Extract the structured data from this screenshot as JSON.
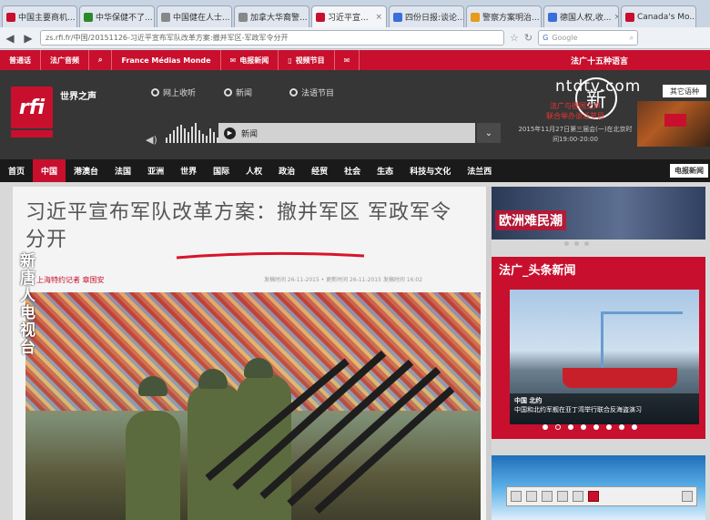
{
  "browser": {
    "tabs": [
      {
        "label": "中国主要商机...",
        "color": "#c8102e"
      },
      {
        "label": "中华保健不了...",
        "color": "#2a8a2a"
      },
      {
        "label": "中国健在人士...",
        "color": "#888888"
      },
      {
        "label": "加拿大华裔警...",
        "color": "#888888"
      },
      {
        "label": "习近平宣...",
        "color": "#c8102e",
        "active": true
      },
      {
        "label": "四份日报:谈论...",
        "color": "#3a6fd8"
      },
      {
        "label": "警察方案明治...",
        "color": "#e89a1b"
      },
      {
        "label": "德国人权,收...",
        "color": "#3a6fd8"
      },
      {
        "label": "Canada's Mo...",
        "color": "#c8102e"
      }
    ],
    "url": "zs.rfi.fr/中国/20151126-习近平宣布军队改革方案:撤并军区-军政军令分开",
    "search_placeholder": "Google"
  },
  "site": {
    "top_links": [
      "普通话",
      "法广音频",
      "France Médias Monde",
      "电报新闻",
      "视频节目"
    ],
    "top_right": "法广十五种语言",
    "slogan": "世界之声",
    "radio_options": [
      "网上收听",
      "新闻",
      "法语节目"
    ],
    "player_label": "新闻",
    "promo_line1": "法广与德国之声",
    "promo_line2": "联合举办谈话节目",
    "promo_date": "2015年11月27日第三届会(一)在北京时间19:00-20:00",
    "lang_button": "其它语种",
    "watermark": "ntdtv.com",
    "watermark_badge": "新",
    "nav": [
      "首页",
      "中国",
      "港澳台",
      "法国",
      "亚洲",
      "世界",
      "国际",
      "人权",
      "政治",
      "经贸",
      "社会",
      "生态",
      "科技与文化",
      "法兰西"
    ],
    "nav_active_index": 1,
    "nav_tail": "电报新闻"
  },
  "article": {
    "headline": "习近平宣布军队改革方案：撤并军区 军政军令分开",
    "byline": "上海特约记者 章国安",
    "times": "发稿时间 26-11-2015 • 更新时间 26-11-2015 发稿时间 16:02",
    "vertical_watermark": "新唐人电视台"
  },
  "sidebar": {
    "banner_title": "欧洲难民潮",
    "news_header": "法广_头条新闻",
    "news_caption_title": "中国 北约",
    "news_caption_text": "中国和北约军舰在亚丁湾举行联合反海盗演习",
    "news_dots": 8,
    "news_dot_active": 1
  },
  "colors": {
    "brand_red": "#c8102e",
    "header_dark": "#363636",
    "nav_black": "#1a1a1a"
  }
}
